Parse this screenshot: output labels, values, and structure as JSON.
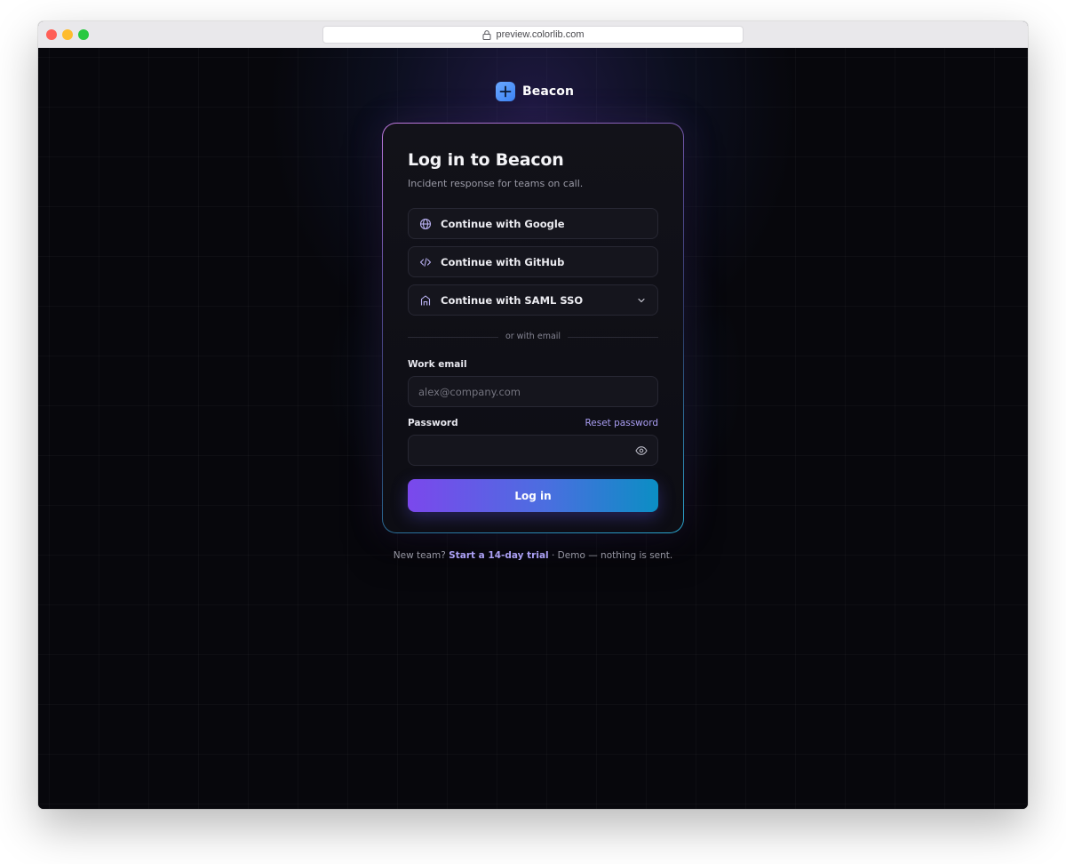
{
  "browser": {
    "url": "preview.colorlib.com"
  },
  "brand": {
    "name": "Beacon"
  },
  "card": {
    "title": "Log in to Beacon",
    "subtitle": "Incident response for teams on call.",
    "sso_buttons": [
      {
        "label": "Continue with Google",
        "icon": "globe-icon"
      },
      {
        "label": "Continue with GitHub",
        "icon": "code-icon"
      },
      {
        "label": "Continue with SAML SSO",
        "icon": "building-icon"
      }
    ],
    "divider_text": "or with email",
    "email": {
      "label": "Work email",
      "placeholder": "alex@company.com",
      "value": ""
    },
    "password": {
      "label": "Password",
      "reset_link": "Reset password",
      "value": ""
    },
    "login_button": "Log in"
  },
  "footer": {
    "prefix": "New team?",
    "trial_link": "Start a 14-day trial",
    "suffix": "· Demo — nothing is sent."
  },
  "colors": {
    "accent_start": "#7b48ec",
    "accent_end": "#0b8ec4",
    "link": "#a99df2",
    "brand_logo": "#3d86f5",
    "background": "#07070c"
  }
}
